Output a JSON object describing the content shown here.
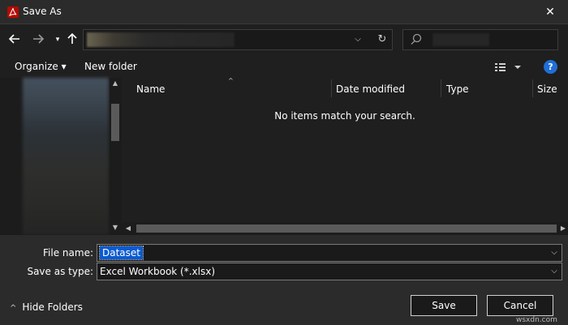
{
  "window": {
    "title": "Save As",
    "close_glyph": "✕",
    "app_icon": "acrobat-icon"
  },
  "nav": {
    "back_glyph": "🡐",
    "forward_glyph": "🡒",
    "recent_glyph": "▾",
    "up_glyph": "🡑",
    "address_value": "",
    "address_chevron": "⌵",
    "refresh_glyph": "↻",
    "search_placeholder": ""
  },
  "toolbar": {
    "organize_label": "Organize ▾",
    "new_folder_label": "New folder",
    "help_label": "?"
  },
  "file_list": {
    "columns": [
      "Name",
      "Date modified",
      "Type",
      "Size"
    ],
    "sort_glyph": "^",
    "empty_message": "No items match your search."
  },
  "form": {
    "file_name_label": "File name:",
    "file_name_value": "Dataset",
    "save_type_label": "Save as type:",
    "save_type_value": "Excel Workbook (*.xlsx)",
    "chevron": "⌵"
  },
  "footer": {
    "hide_folders_label": "Hide Folders",
    "hide_folders_chevron": "^",
    "save_label": "Save",
    "cancel_label": "Cancel",
    "watermark": "wsxdn.com"
  },
  "colors": {
    "background": "#1f1f1f",
    "titlebar": "#2b2b2b",
    "selection": "#0a5bd2",
    "help": "#1f6fd6",
    "app_icon": "#b30b00"
  }
}
